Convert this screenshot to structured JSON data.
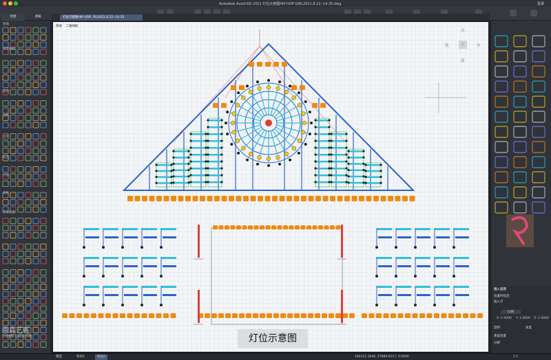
{
  "window": {
    "title": "Autodesk AutoCAD 2021    灯位示意图HIP HOP GIRL2021.8.12--14.35.dwg",
    "user": "登录",
    "traffic_colors": [
      "#fc5f57",
      "#fdbc2e",
      "#28c840"
    ]
  },
  "left_panel": {
    "tabs": [
      "绘图",
      "源编"
    ],
    "sections": [
      "绘图",
      "修改编辑",
      "修改",
      "注释",
      "文字",
      "标注",
      "引线",
      "表格",
      "参照绘图"
    ]
  },
  "file_tab": {
    "label": "灯位示意图HIP HOP...RL2021.8.12--14.35"
  },
  "viewport": {
    "labels": [
      "俯视",
      "二维线框"
    ],
    "compass": {
      "north": "北",
      "west": "西",
      "center": "上",
      "east": "东",
      "south": "南"
    }
  },
  "drawing": {
    "caption": "灯位示意图",
    "colors": {
      "structure": "#2f62c8",
      "fixture_orange": "#f08a12",
      "fixture_yellow": "#f0c71b",
      "fixture_cyan": "#2cc1dc",
      "red_guide": "#e03b3b",
      "green": "#36b54a"
    }
  },
  "right_panel": {
    "palette_header_icons": [
      "settings-icon",
      "star-icon",
      "grid-icon",
      "search-icon",
      "list-icon"
    ],
    "properties": {
      "header": "插入选项",
      "rows": [
        "放置时指定:",
        "插入点",
        "比例",
        "X: 1.0000",
        "Y: 1.0000",
        "Z: 1.0000",
        "旋转",
        "角度",
        "重复放置",
        "分解"
      ]
    }
  },
  "status_bar": {
    "coords": "182221.2846, 27886.6517, 0.0000",
    "tabs": [
      "模型",
      "布局1",
      "布局2"
    ],
    "scale": "1:1"
  },
  "watermark": {
    "text": "崇真艺客",
    "sub": "THEME CREATIVE"
  }
}
